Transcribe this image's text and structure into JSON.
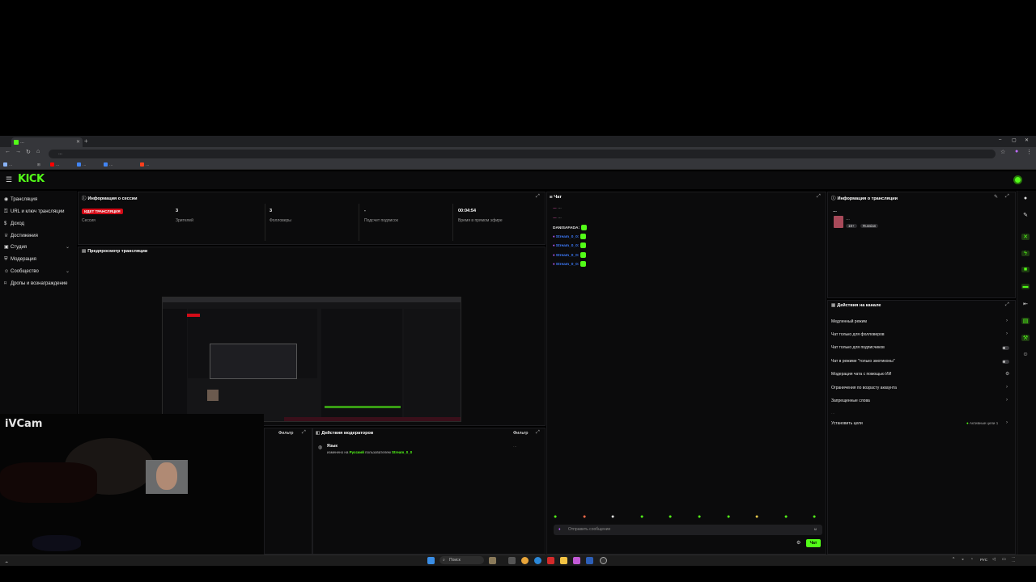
{
  "browser": {
    "tab_title": "…",
    "url": "…",
    "bookmarks": [
      {
        "label": "…",
        "color": "#8ab4f8"
      },
      {
        "label": "…",
        "color": "#ff0000"
      },
      {
        "label": "…",
        "color": "#4285f4"
      },
      {
        "label": "…",
        "color": "#4285f4"
      },
      {
        "label": "…",
        "color": "#fc3f1d"
      }
    ]
  },
  "brand": {
    "logo": "KICK",
    "accent": "#53fc18"
  },
  "sidebar": {
    "items": [
      {
        "label": "Трансляция",
        "icon": "broadcast-icon"
      },
      {
        "label": "URL и ключ трансляции",
        "icon": "key-icon"
      },
      {
        "label": "Доход",
        "icon": "dollar-icon"
      },
      {
        "label": "Достижения",
        "icon": "trophy-icon"
      },
      {
        "label": "Студия",
        "icon": "studio-icon",
        "expandable": true
      },
      {
        "label": "Модерация",
        "icon": "shield-icon"
      },
      {
        "label": "Сообщество",
        "icon": "community-icon",
        "expandable": true
      },
      {
        "label": "Дропы и вознаграждение",
        "icon": "gift-icon"
      }
    ]
  },
  "session": {
    "title": "Информация о сессии",
    "live_badge": "ИДЕТ ТРАНСЛЯЦИЯ",
    "stats": [
      {
        "value": "",
        "label": "Сессия"
      },
      {
        "value": "3",
        "label": "Зрителей"
      },
      {
        "value": "3",
        "label": "Фолловеры"
      },
      {
        "value": "-",
        "label": "Подсчет подписок"
      },
      {
        "value": "00:04:54",
        "label": "Время в прямом эфире"
      }
    ]
  },
  "preview": {
    "title": "Предпросмотр трансляции",
    "overlay_label": "iVCam"
  },
  "mod_actions": {
    "title": "Действия модераторов",
    "filter": "Фильтр",
    "left_filter": "Фильтр",
    "entry_title": "Язык",
    "entry_text_pre": "изменено на",
    "entry_lang": "Русский",
    "entry_text_mid": "пользователем",
    "entry_user": "Stream_0_0",
    "entry_time": "…"
  },
  "chat": {
    "title": "Чат",
    "messages": [
      {
        "user": "…",
        "color": "#ff5ec4",
        "text": "…"
      },
      {
        "user": "…",
        "color": "#ff5ec4",
        "text": "…"
      },
      {
        "user": "DANISAFADA:",
        "color": "#e6e6e6",
        "text": ""
      },
      {
        "user": "Stream_0_0:",
        "color": "#3d7bfd",
        "text": ""
      },
      {
        "user": "Stream_0_0:",
        "color": "#3d7bfd",
        "text": ""
      },
      {
        "user": "Stream_0_0:",
        "color": "#3d7bfd",
        "text": ""
      },
      {
        "user": "Stream_0_0:",
        "color": "#3d7bfd",
        "text": ""
      }
    ],
    "input_placeholder": "Отправить сообщение",
    "send_label": "Чат"
  },
  "stream_info": {
    "title": "Информация о трансляции",
    "stream_title": "…",
    "category": "…",
    "tags": [
      "18+",
      "Russian"
    ]
  },
  "channel_actions": {
    "title": "Действия на канале",
    "items": [
      {
        "label": "Медленный режим",
        "control": "chevron"
      },
      {
        "label": "Чат только для фолловеров",
        "control": "chevron"
      },
      {
        "label": "Чат только для подписчиков",
        "control": "toggle"
      },
      {
        "label": "Чат в режиме \"только эмотиконы\"",
        "control": "toggle"
      },
      {
        "label": "Модерация чата с помощью ИИ",
        "control": "settings"
      },
      {
        "label": "Ограничения по возрасту аккаунта",
        "control": "chevron"
      },
      {
        "label": "Запрещенные слова",
        "control": "chevron"
      }
    ],
    "subtitle": "…",
    "goal_label": "Установить цели",
    "goal_status": "Активные цели",
    "goal_count": "1"
  },
  "taskbar": {
    "search_label": "Поиск",
    "tray_lang": "РУС",
    "time": "…",
    "date": "…"
  }
}
